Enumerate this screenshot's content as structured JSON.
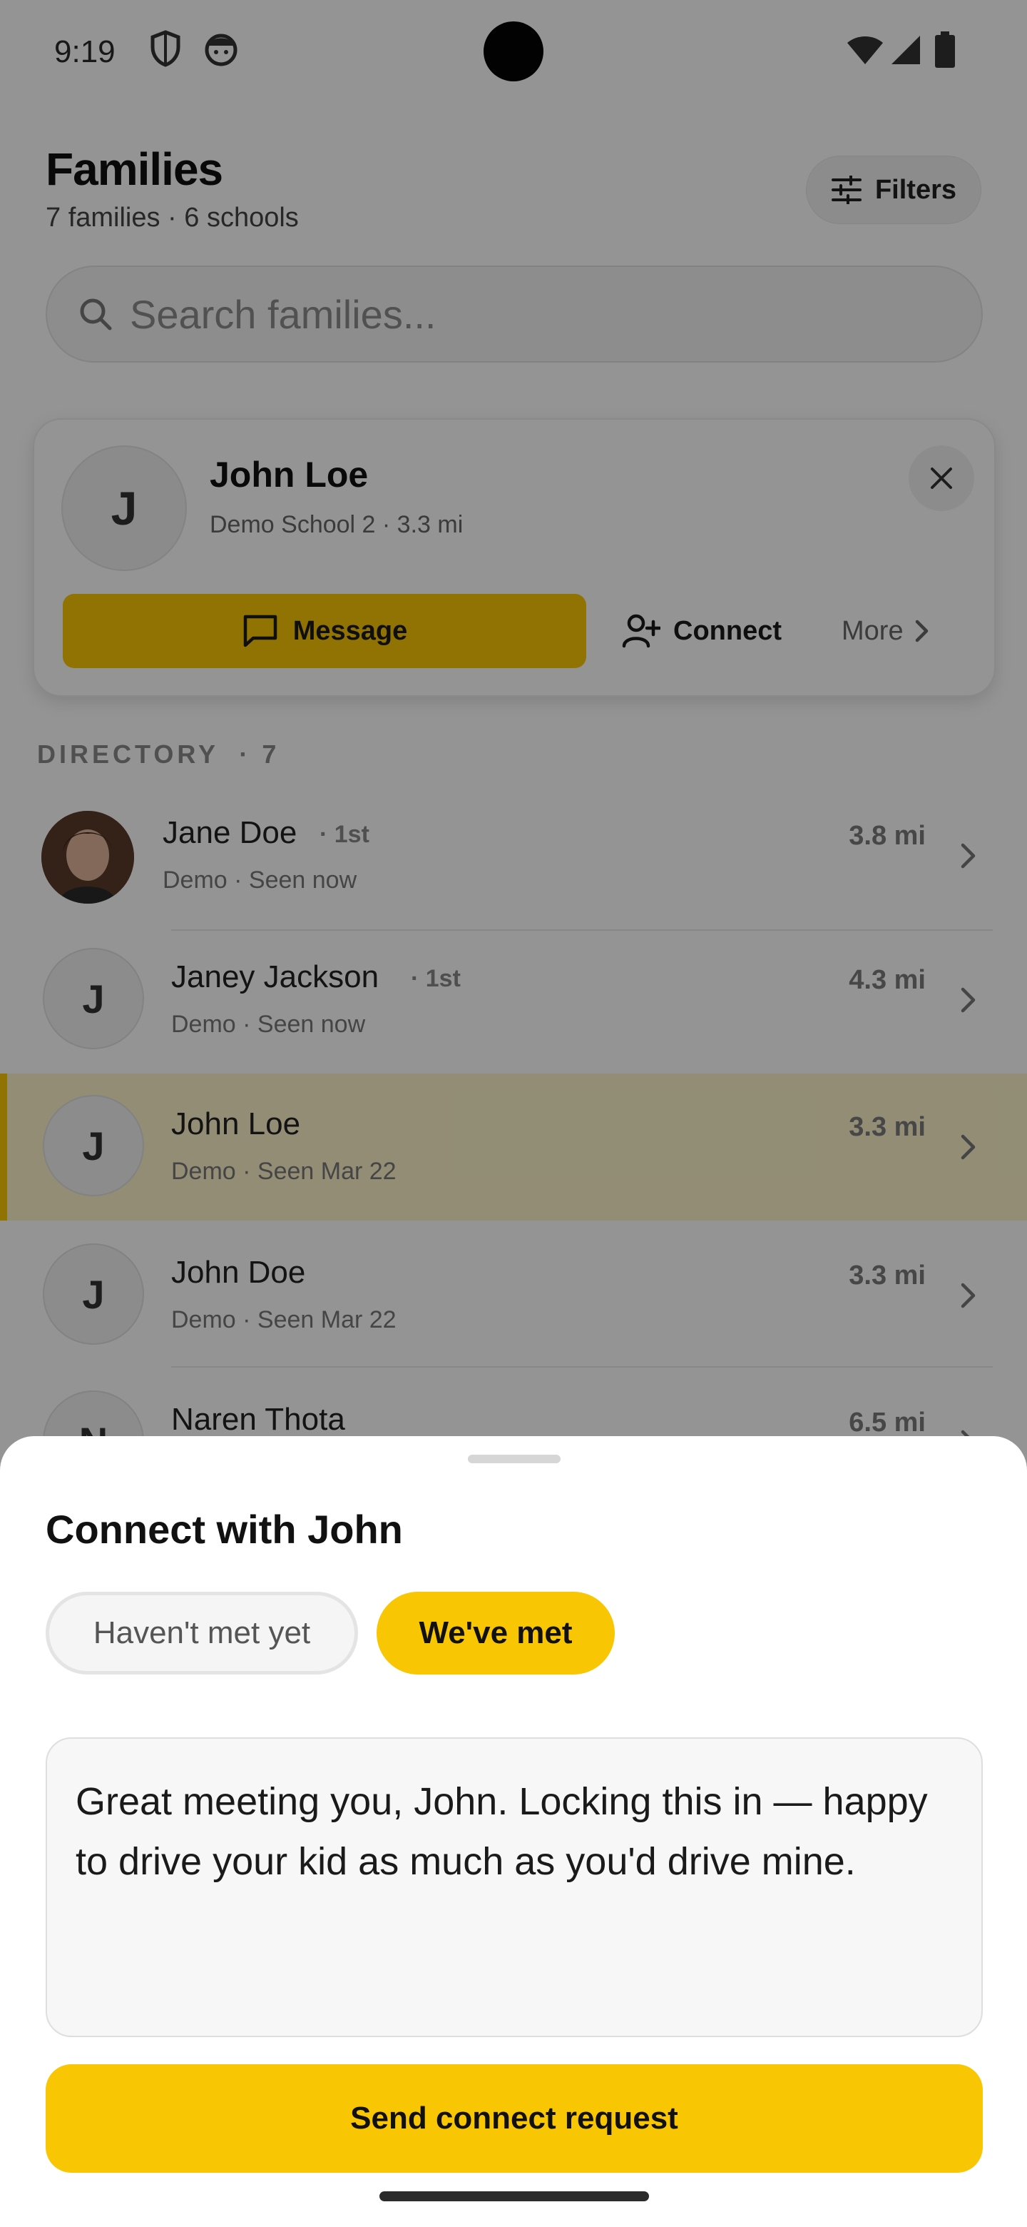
{
  "status_bar": {
    "time": "9:19"
  },
  "header": {
    "title": "Families",
    "subtitle": "7 families · 6 schools",
    "filters_label": "Filters"
  },
  "search": {
    "placeholder": "Search families..."
  },
  "selected_card": {
    "initial": "J",
    "name": "John Loe",
    "subtitle": "Demo School 2 · 3.3 mi",
    "message_label": "Message",
    "connect_label": "Connect",
    "more_label": "More"
  },
  "directory": {
    "label": "DIRECTORY",
    "count": "· 7",
    "rows": [
      {
        "initial": "",
        "name": "Jane Doe",
        "degree": "· 1st",
        "meta": "Demo · Seen now",
        "distance": "3.8 mi",
        "photo": true
      },
      {
        "initial": "J",
        "name": "Janey Jackson",
        "degree": "· 1st",
        "meta": "Demo · Seen now",
        "distance": "4.3 mi"
      },
      {
        "initial": "J",
        "name": "John Loe",
        "degree": "",
        "meta": "Demo · Seen Mar 22",
        "distance": "3.3 mi",
        "selected": true
      },
      {
        "initial": "J",
        "name": "John Doe",
        "degree": "",
        "meta": "Demo · Seen Mar 22",
        "distance": "3.3 mi"
      },
      {
        "initial": "N",
        "name": "Naren Thota",
        "degree": "",
        "meta": "",
        "distance": "6.5 mi"
      }
    ]
  },
  "sheet": {
    "title": "Connect with John",
    "option_not_met": "Haven't met yet",
    "option_met": "We've met",
    "selected_option": "We've met",
    "message": "Great meeting you, John. Locking this in — happy to drive your kid as much as you'd drive mine.",
    "send_label": "Send connect request"
  },
  "colors": {
    "accent": "#f9c604",
    "selected_row": "#fbf3c9"
  },
  "icons": [
    "shield-icon",
    "face-icon",
    "wifi-icon",
    "signal-icon",
    "battery-icon",
    "sliders-icon",
    "search-icon",
    "close-icon",
    "chat-bubble-icon",
    "person-add-icon",
    "chevron-right-icon"
  ]
}
